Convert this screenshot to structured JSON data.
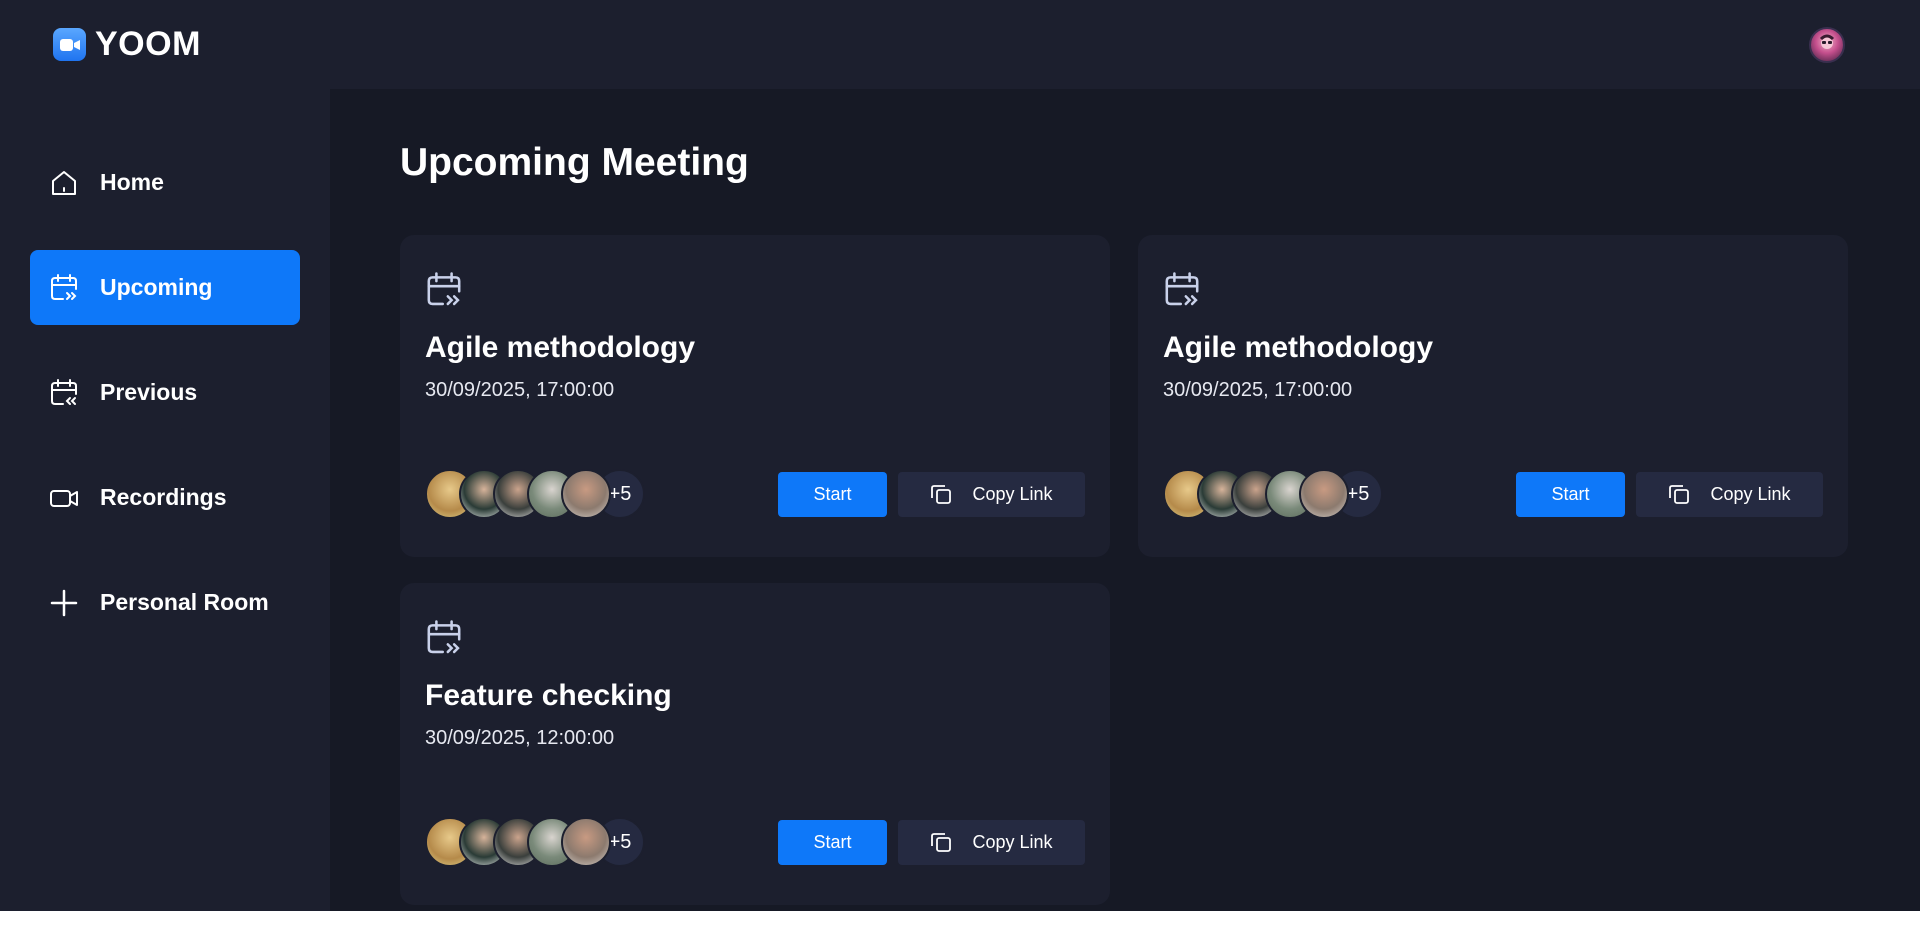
{
  "app": {
    "name": "YOOM"
  },
  "sidebar": {
    "items": [
      {
        "label": "Home",
        "icon": "home-icon",
        "active": false
      },
      {
        "label": "Upcoming",
        "icon": "calendar-upcoming-icon",
        "active": true
      },
      {
        "label": "Previous",
        "icon": "calendar-previous-icon",
        "active": false
      },
      {
        "label": "Recordings",
        "icon": "video-icon",
        "active": false
      },
      {
        "label": "Personal Room",
        "icon": "plus-icon",
        "active": false
      }
    ]
  },
  "main": {
    "title": "Upcoming Meeting",
    "meetings": [
      {
        "title": "Agile methodology",
        "date": "30/09/2025, 17:00:00",
        "attendees_more": "+5",
        "start_label": "Start",
        "copy_label": "Copy Link"
      },
      {
        "title": "Agile methodology",
        "date": "30/09/2025, 17:00:00",
        "attendees_more": "+5",
        "start_label": "Start",
        "copy_label": "Copy Link"
      },
      {
        "title": "Feature checking",
        "date": "30/09/2025, 12:00:00",
        "attendees_more": "+5",
        "start_label": "Start",
        "copy_label": "Copy Link"
      }
    ]
  },
  "colors": {
    "accent": "#0e78f9",
    "surface": "#1c1f2e",
    "background": "#161925",
    "secondary_button": "#252a41"
  }
}
